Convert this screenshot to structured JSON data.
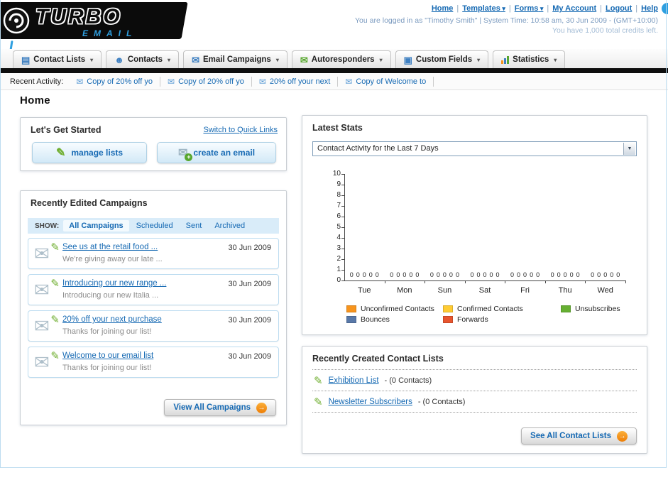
{
  "branding": {
    "logo_primary": "TURBO",
    "logo_secondary": "EMAIL"
  },
  "top_nav": {
    "links": [
      {
        "label": "Home",
        "dropdown": false
      },
      {
        "label": "Templates",
        "dropdown": true
      },
      {
        "label": "Forms",
        "dropdown": true
      },
      {
        "label": "My Account",
        "dropdown": false
      },
      {
        "label": "Logout",
        "dropdown": false
      },
      {
        "label": "Help",
        "dropdown": false
      }
    ],
    "login_status": "You are logged in as \"Timothy Smith\" | System Time: 10:58 am, 30 Jun 2009 - (GMT+10:00)",
    "credits": "You have 1,000 total credits left."
  },
  "main_nav": {
    "tabs": [
      {
        "label": "Contact Lists",
        "icon": "contact-lists-icon"
      },
      {
        "label": "Contacts",
        "icon": "contacts-icon"
      },
      {
        "label": "Email Campaigns",
        "icon": "email-campaigns-icon"
      },
      {
        "label": "Autoresponders",
        "icon": "autoresponders-icon"
      },
      {
        "label": "Custom Fields",
        "icon": "custom-fields-icon"
      },
      {
        "label": "Statistics",
        "icon": "statistics-icon"
      }
    ]
  },
  "recent_activity": {
    "label": "Recent Activity:",
    "items": [
      "Copy of 20% off yo",
      "Copy of 20% off yo",
      "20% off your next",
      "Copy of Welcome to"
    ]
  },
  "page": {
    "title": "Home"
  },
  "get_started": {
    "title": "Let's Get Started",
    "switch_link": "Switch to Quick Links",
    "manage_lists_label": "manage lists",
    "create_email_label": "create an email"
  },
  "campaigns": {
    "title": "Recently Edited Campaigns",
    "show_label": "SHOW:",
    "filters": [
      {
        "label": "All Campaigns",
        "selected": true
      },
      {
        "label": "Scheduled",
        "selected": false
      },
      {
        "label": "Sent",
        "selected": false
      },
      {
        "label": "Archived",
        "selected": false
      }
    ],
    "items": [
      {
        "title": "See us at the retail food ...",
        "subtitle": "We're giving away our late ...",
        "date": "30 Jun 2009"
      },
      {
        "title": "Introducing our new range ...",
        "subtitle": "Introducing our new Italia ...",
        "date": "30 Jun 2009"
      },
      {
        "title": "20% off your next purchase",
        "subtitle": "Thanks for joining our list!",
        "date": "30 Jun 2009"
      },
      {
        "title": "Welcome to our email list",
        "subtitle": "Thanks for joining our list!",
        "date": "30 Jun 2009"
      }
    ],
    "view_all_label": "View All Campaigns"
  },
  "latest_stats": {
    "title": "Latest Stats",
    "selected_option": "Contact Activity for the Last 7 Days",
    "chart_data": {
      "type": "bar",
      "title": "Contact Activity for the Last 7 Days",
      "categories": [
        "Tue",
        "Mon",
        "Sun",
        "Sat",
        "Fri",
        "Thu",
        "Wed"
      ],
      "series": [
        {
          "name": "Unconfirmed Contacts",
          "color": "#f7941d",
          "values": [
            0,
            0,
            0,
            0,
            0,
            0,
            0
          ]
        },
        {
          "name": "Confirmed Contacts",
          "color": "#ffcc33",
          "values": [
            0,
            0,
            0,
            0,
            0,
            0,
            0
          ]
        },
        {
          "name": "Unsubscribes",
          "color": "#66b032",
          "values": [
            0,
            0,
            0,
            0,
            0,
            0,
            0
          ]
        },
        {
          "name": "Bounces",
          "color": "#5878a8",
          "values": [
            0,
            0,
            0,
            0,
            0,
            0,
            0
          ]
        },
        {
          "name": "Forwards",
          "color": "#e8552e",
          "values": [
            0,
            0,
            0,
            0,
            0,
            0,
            0
          ]
        }
      ],
      "xlabel": "",
      "ylabel": "",
      "ylim": [
        0,
        10
      ],
      "ytick_step": 1,
      "grid": false,
      "legend_position": "bottom"
    }
  },
  "contact_lists": {
    "title": "Recently Created Contact Lists",
    "items": [
      {
        "name": "Exhibition List",
        "detail": "- (0 Contacts)"
      },
      {
        "name": "Newsletter Subscribers",
        "detail": "- (0 Contacts)"
      }
    ],
    "see_all_label": "See All Contact Lists"
  }
}
